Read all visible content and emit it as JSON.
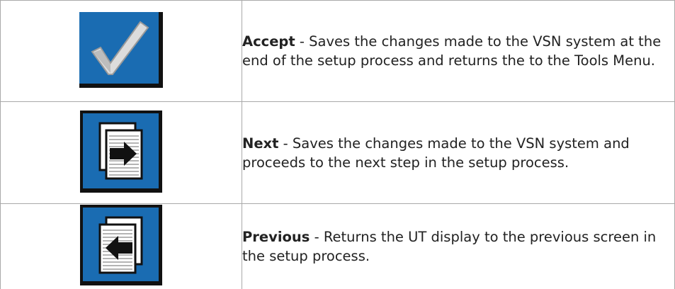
{
  "items": [
    {
      "term": "Accept",
      "separator": " - ",
      "description": "Saves the changes made to the VSN system at the end of the setup process and returns the to the Tools Menu.",
      "icon": "checkmark-icon"
    },
    {
      "term": "Next",
      "separator": " - ",
      "description": "Saves the changes made to the VSN system and proceeds to the next step in the setup process.",
      "icon": "next-page-arrow-icon"
    },
    {
      "term": "Previous",
      "separator": " - ",
      "description": "Returns the UT display to the previous screen in the setup process.",
      "icon": "previous-page-arrow-icon"
    }
  ],
  "colors": {
    "button_blue": "#1a6cb2",
    "button_frame": "#111111",
    "border": "#a9a9a9"
  }
}
